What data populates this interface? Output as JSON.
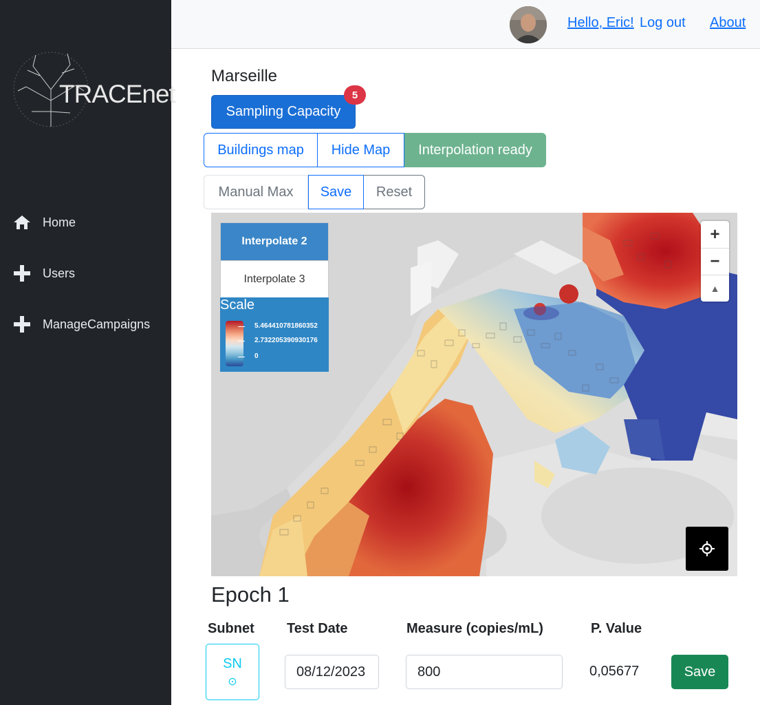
{
  "sidebar": {
    "logo_text": "TRACEnet",
    "items": [
      {
        "label": "Home",
        "icon": "home-icon"
      },
      {
        "label": "Users",
        "icon": "plus-icon"
      },
      {
        "label": "ManageCampaigns",
        "icon": "plus-icon"
      }
    ]
  },
  "header": {
    "greeting": "Hello, Eric!",
    "logout": "Log out",
    "about": "About"
  },
  "main": {
    "city": "Marseille",
    "sampling_button": "Sampling Capacity",
    "badge_count": "5",
    "map_buttons": {
      "buildings": "Buildings map",
      "hide": "Hide Map",
      "status": "Interpolation ready"
    },
    "max_buttons": {
      "manual": "Manual Max",
      "save": "Save",
      "reset": "Reset"
    },
    "map": {
      "interpolate_active": "Interpolate 2",
      "interpolate_other": "Interpolate 3",
      "scale_title": "Scale",
      "scale_max": "5.464410781860352",
      "scale_mid": "2.732205390930176",
      "scale_min": "0",
      "zoom_in": "+",
      "zoom_out": "−",
      "reset_north": "▲"
    },
    "epoch": {
      "title": "Epoch 1",
      "headers": {
        "subnet": "Subnet",
        "test_date": "Test Date",
        "measure": "Measure (copies/mL)",
        "pvalue": "P. Value"
      },
      "subnet_label": "SN",
      "subnet_icon": "⊙",
      "test_date": "08/12/2023",
      "measure": "800",
      "pvalue": "0,05677",
      "save": "Save"
    }
  },
  "colors": {
    "sidebar_bg": "#212529",
    "primary": "#0d6efd",
    "success": "#6db38f",
    "danger": "#dc3545",
    "save_green": "#198754"
  }
}
